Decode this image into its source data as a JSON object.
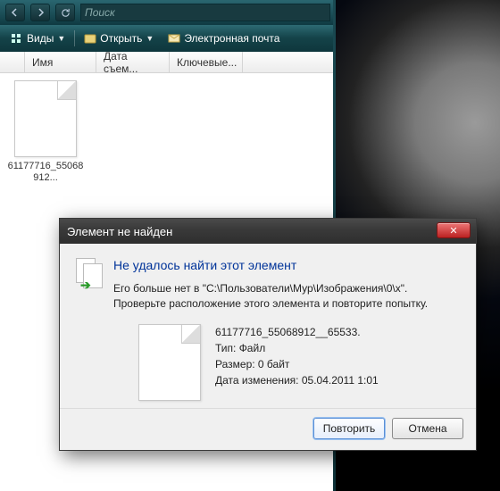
{
  "explorer": {
    "search_placeholder": "Поиск",
    "toolbar": {
      "views": "Виды",
      "open": "Открыть",
      "email": "Электронная почта"
    },
    "columns": {
      "name": "Имя",
      "date": "Дата съем...",
      "tags": "Ключевые..."
    },
    "file": {
      "label": "61177716_55068912..."
    }
  },
  "dialog": {
    "title": "Элемент не найден",
    "heading": "Не удалось найти этот элемент",
    "message": "Его больше нет в \"C:\\Пользователи\\Мур\\Изображения\\0\\x\". Проверьте расположение этого элемента и повторите попытку.",
    "file": {
      "name": "61177716_55068912__65533.",
      "type_label": "Тип:",
      "type_value": "Файл",
      "size_label": "Размер:",
      "size_value": "0 байт",
      "mod_label": "Дата изменения:",
      "mod_value": "05.04.2011 1:01"
    },
    "buttons": {
      "retry": "Повторить",
      "cancel": "Отмена"
    }
  }
}
